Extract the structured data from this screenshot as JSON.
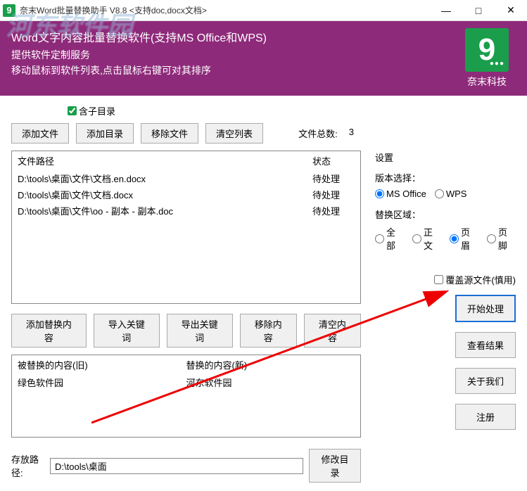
{
  "titlebar": {
    "icon_letter": "9",
    "title": "奈末Word批量替换助手   V8.8  <支持doc,docx文档>",
    "min": "—",
    "max": "□",
    "close": "✕"
  },
  "header": {
    "line1": "Word文字内容批量替换软件(支持MS Office和WPS)",
    "line2": "提供软件定制服务",
    "line3": "移动鼠标到软件列表,点击鼠标右键可对其排序",
    "logo_text": "奈末科技",
    "logo_letter": "9",
    "logo_dots": "●●●"
  },
  "include_sub": "含子目录",
  "toolbar1": {
    "add_file": "添加文件",
    "add_dir": "添加目录",
    "remove_file": "移除文件",
    "clear_list": "清空列表"
  },
  "file_count_label": "文件总数:",
  "file_count_value": "3",
  "file_table": {
    "header_path": "文件路径",
    "header_status": "状态",
    "rows": [
      {
        "path": "D:\\tools\\桌面\\文件\\文档.en.docx",
        "status": "待处理"
      },
      {
        "path": "D:\\tools\\桌面\\文件\\文档.docx",
        "status": "待处理"
      },
      {
        "path": "D:\\tools\\桌面\\文件\\oo - 副本 - 副本.doc",
        "status": "待处理"
      }
    ]
  },
  "settings": {
    "title": "设置",
    "version_label": "版本选择：",
    "version_opts": {
      "msoffice": "MS Office",
      "wps": "WPS"
    },
    "area_label": "替换区域：",
    "area_opts": {
      "all": "全部",
      "body": "正文",
      "header": "页眉",
      "footer": "页脚"
    }
  },
  "overwrite": "覆盖源文件(慎用)",
  "actions": {
    "start": "开始处理",
    "view": "查看结果",
    "about": "关于我们",
    "register": "注册"
  },
  "toolbar2": {
    "add_replace": "添加替换内容",
    "import_kw": "导入关键词",
    "export_kw": "导出关键词",
    "remove": "移除内容",
    "clear": "清空内容"
  },
  "replace_table": {
    "header_old": "被替换的内容(旧)",
    "header_new": "替换的内容(新)",
    "rows": [
      {
        "old": "绿色软件园",
        "new": "河东软件园"
      }
    ]
  },
  "save": {
    "label": "存放路径:",
    "path": "D:\\tools\\桌面",
    "btn": "修改目录"
  },
  "watermark": "河东软件园"
}
